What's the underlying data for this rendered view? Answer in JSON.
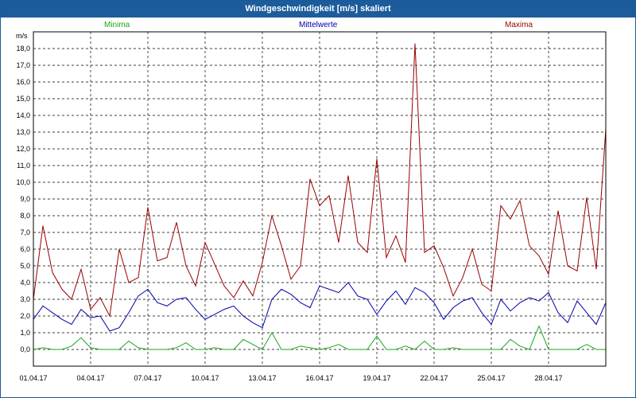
{
  "window": {
    "title": "Windgeschwindigkeit [m/s] skaliert"
  },
  "colors": {
    "min": "#1aa81a",
    "mean": "#0000aa",
    "max": "#990000",
    "title_bar": "#1c5c9c"
  },
  "chart_data": {
    "type": "line",
    "title": "Windgeschwindigkeit [m/s] skaliert",
    "ylabel": "m/s",
    "xlabel": "",
    "ylim": [
      -1,
      19
    ],
    "xlim": [
      0,
      30
    ],
    "grid": true,
    "legend_position": "top",
    "y_ticks": [
      "0,0",
      "1,0",
      "2,0",
      "3,0",
      "4,0",
      "5,0",
      "6,0",
      "7,0",
      "8,0",
      "9,0",
      "10,0",
      "11,0",
      "12,0",
      "13,0",
      "14,0",
      "15,0",
      "16,0",
      "17,0",
      "18,0"
    ],
    "x_tick_labels": [
      "01.04.17",
      "04.04.17",
      "07.04.17",
      "10.04.17",
      "13.04.17",
      "16.04.17",
      "19.04.17",
      "22.04.17",
      "25.04.17",
      "28.04.17"
    ],
    "x_tick_days": [
      0,
      3,
      6,
      9,
      12,
      15,
      18,
      21,
      24,
      27
    ],
    "x_step_days": 0.5,
    "series": [
      {
        "name": "Minima",
        "color": "#1aa81a",
        "values": [
          0.0,
          0.1,
          0.0,
          0.0,
          0.2,
          0.7,
          0.1,
          0.0,
          0.0,
          0.0,
          0.5,
          0.1,
          0.0,
          0.0,
          0.0,
          0.1,
          0.4,
          0.0,
          0.0,
          0.1,
          0.0,
          0.0,
          0.6,
          0.3,
          0.0,
          1.0,
          0.0,
          0.0,
          0.2,
          0.1,
          0.0,
          0.1,
          0.3,
          0.0,
          0.0,
          0.0,
          0.8,
          0.0,
          0.0,
          0.2,
          0.0,
          0.5,
          0.0,
          0.0,
          0.1,
          0.0,
          0.0,
          0.0,
          0.0,
          0.0,
          0.6,
          0.2,
          0.0,
          1.4,
          0.0,
          0.0,
          0.0,
          0.0,
          0.3,
          0.0,
          0.0
        ]
      },
      {
        "name": "Mittelwerte",
        "color": "#0000aa",
        "values": [
          1.8,
          2.6,
          2.2,
          1.8,
          1.5,
          2.4,
          1.9,
          2.0,
          1.1,
          1.3,
          2.2,
          3.2,
          3.6,
          2.8,
          2.6,
          3.0,
          3.1,
          2.4,
          1.8,
          2.1,
          2.4,
          2.6,
          2.0,
          1.6,
          1.3,
          3.0,
          3.6,
          3.3,
          2.8,
          2.5,
          3.8,
          3.6,
          3.4,
          4.0,
          3.2,
          3.0,
          2.1,
          2.9,
          3.5,
          2.7,
          3.7,
          3.4,
          2.8,
          1.8,
          2.5,
          2.9,
          3.1,
          2.2,
          1.5,
          3.0,
          2.3,
          2.8,
          3.1,
          2.9,
          3.4,
          2.2,
          1.6,
          2.9,
          2.2,
          1.5,
          2.8
        ]
      },
      {
        "name": "Maxima",
        "color": "#990000",
        "values": [
          3.0,
          7.4,
          4.6,
          3.6,
          3.0,
          4.8,
          2.4,
          3.1,
          2.0,
          6.0,
          4.0,
          4.3,
          8.5,
          5.3,
          5.5,
          7.6,
          5.0,
          3.8,
          6.4,
          5.1,
          3.8,
          3.1,
          4.1,
          3.2,
          5.2,
          8.0,
          6.2,
          4.2,
          5.0,
          10.2,
          8.6,
          9.2,
          6.4,
          10.4,
          6.4,
          5.8,
          11.4,
          5.5,
          6.8,
          5.2,
          18.3,
          5.8,
          6.2,
          4.9,
          3.2,
          4.3,
          6.0,
          3.9,
          3.5,
          8.6,
          7.8,
          8.9,
          6.2,
          5.6,
          4.5,
          8.3,
          5.0,
          4.7,
          9.1,
          4.8,
          13.2
        ]
      }
    ]
  }
}
